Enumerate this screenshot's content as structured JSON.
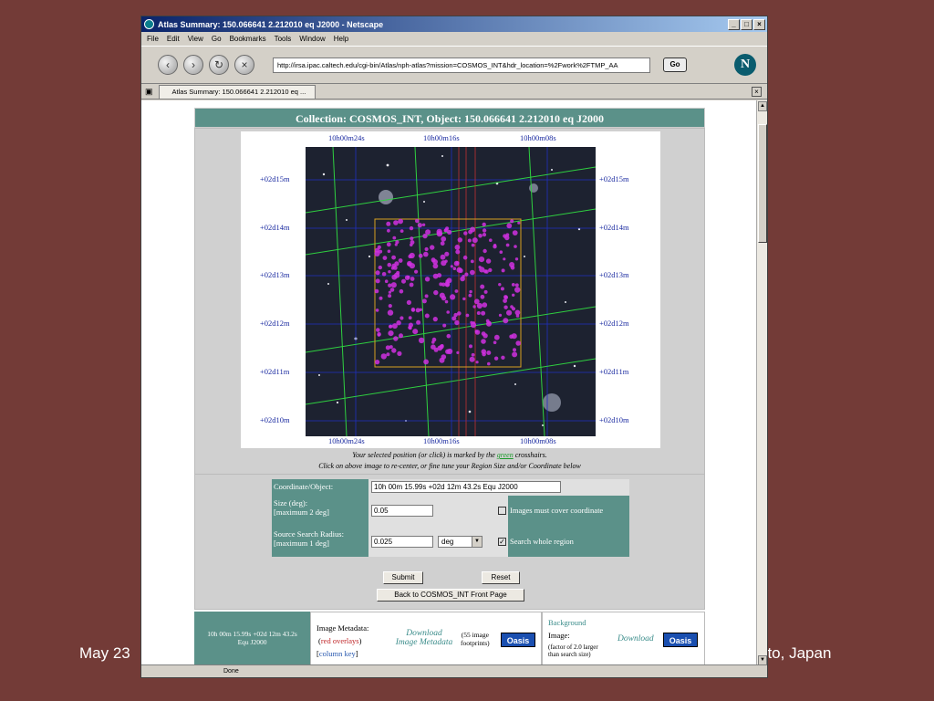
{
  "slide": {
    "footer_left": "May 23",
    "footer_right": "oto, Japan"
  },
  "browser": {
    "window_title": "Atlas Summary: 150.066641 2.212010 eq J2000 - Netscape",
    "menus": [
      "File",
      "Edit",
      "View",
      "Go",
      "Bookmarks",
      "Tools",
      "Window",
      "Help"
    ],
    "url": "http://irsa.ipac.caltech.edu/cgi-bin/Atlas/nph-atlas?mission=COSMOS_INT&hdr_location=%2Fwork%2FTMP_AA",
    "go_label": "Go",
    "tab_title": "Atlas Summary: 150.066641 2.212010 eq ...",
    "status": "Done"
  },
  "page": {
    "header_prefix": "Collection: COSMOS_INT, Object:",
    "header_object": "150.066641 2.212010 eq J2000",
    "axis": {
      "top": [
        "10h00m24s",
        "10h00m16s",
        "10h00m08s"
      ],
      "bottom": [
        "10h00m24s",
        "10h00m16s",
        "10h00m08s"
      ],
      "left": [
        "+02d15m",
        "+02d14m",
        "+02d13m",
        "+02d12m",
        "+02d11m",
        "+02d10m"
      ],
      "right": [
        "+02d15m",
        "+02d14m",
        "+02d13m",
        "+02d12m",
        "+02d11m",
        "+02d10m"
      ]
    },
    "caption1_a": "Your selected position (or click) is marked by the",
    "caption1_green": "green",
    "caption1_b": "crosshairs.",
    "caption2": "Click on above image to re-center, or fine tune your Region Size and/or Coordinate below",
    "form": {
      "coord_label": "Coordinate/Object:",
      "coord_value": "10h 00m 15.99s +02d 12m 43.2s Equ J2000",
      "size_label": "Size (deg):",
      "size_hint": "[maximum 2 deg]",
      "size_value": "0.05",
      "cover_label": "Images must cover coordinate",
      "radius_label": "Source Search Radius:",
      "radius_hint": "[maximum 1 deg]",
      "radius_value": "0.025",
      "unit_value": "deg",
      "whole_region_label": "Search whole region",
      "submit_label": "Submit",
      "reset_label": "Reset",
      "front_page_label": "Back to COSMOS_INT Front Page"
    },
    "results": {
      "coord_line1": "10h 00m 15.99s +02d 12m 43.2s",
      "coord_line2": "Equ J2000",
      "meta_title": "Image Metadata:",
      "red_overlays": "red overlays",
      "column_key": "column key",
      "download_meta_1": "Download",
      "download_meta_2": "Image Metadata",
      "footprints_1": "(55 image",
      "footprints_2": "footprints)",
      "oasis_label": "Oasis",
      "background_title": "Background",
      "image_label": "Image:",
      "factor_1": "(factor of 2.0 larger",
      "factor_2": "than search size)",
      "download_label": "Download"
    }
  }
}
